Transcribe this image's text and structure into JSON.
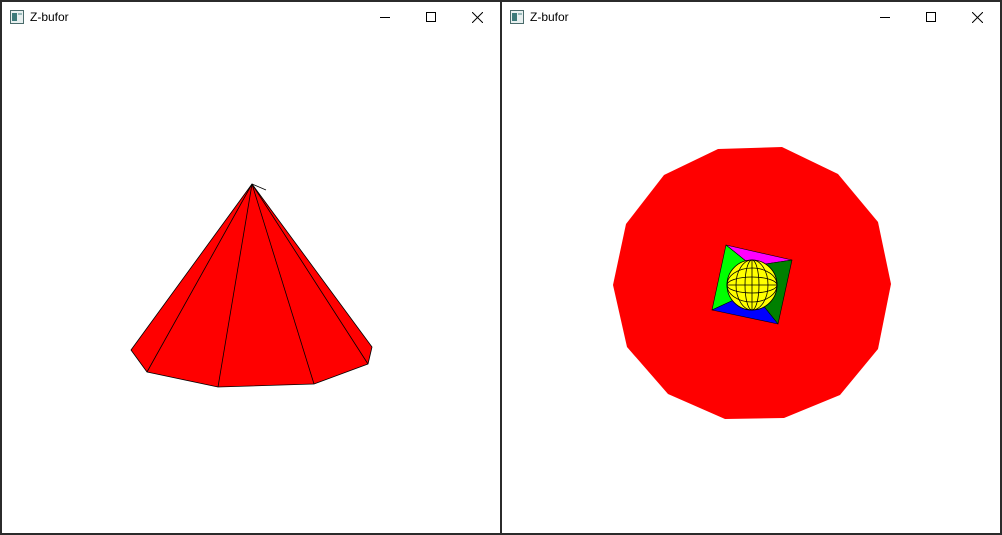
{
  "windows": [
    {
      "title": "Z-bufor",
      "scene": "cone",
      "controls": {
        "minimize": "minimize-icon",
        "maximize": "maximize-icon",
        "close": "close-icon"
      }
    },
    {
      "title": "Z-bufor",
      "scene": "cone-top-view-with-pyramid-and-sphere",
      "controls": {
        "minimize": "minimize-icon",
        "maximize": "maximize-icon",
        "close": "close-icon"
      }
    }
  ],
  "colors": {
    "cone": "#ff0000",
    "pyramid_top": "#ff00ff",
    "pyramid_left": "#00ff00",
    "pyramid_right": "#008000",
    "pyramid_bottom": "#0000ff",
    "pyramid_inner": "#00ffff",
    "sphere": "#ffff00",
    "edge": "#000000"
  }
}
